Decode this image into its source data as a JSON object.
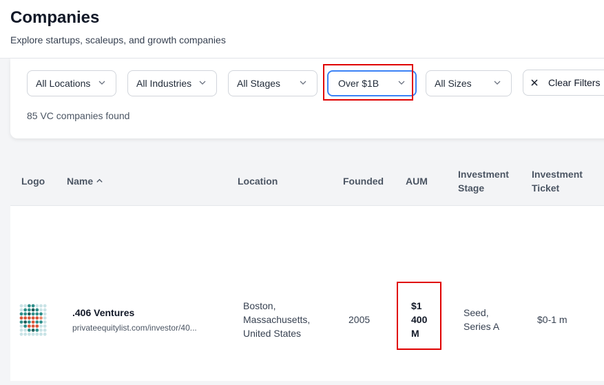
{
  "header": {
    "title": "Companies",
    "subtitle": "Explore startups, scaleups, and growth companies"
  },
  "filters": {
    "location": "All Locations",
    "industry": "All Industries",
    "stage": "All Stages",
    "aum": "Over $1B",
    "size": "All Sizes",
    "clear_label": "Clear Filters"
  },
  "results": {
    "count_text": "85 VC companies found"
  },
  "table": {
    "columns": {
      "logo": "Logo",
      "name": "Name",
      "location": "Location",
      "founded": "Founded",
      "aum": "AUM",
      "stage_line1": "Investment",
      "stage_line2": "Stage",
      "ticket_line1": "Investment",
      "ticket_line2": "Ticket"
    },
    "rows": [
      {
        "name": ".406 Ventures",
        "url": "privateequitylist.com/investor/40...",
        "location_line1": "Boston,",
        "location_line2": "Massachusetts,",
        "location_line3": "United States",
        "founded": "2005",
        "aum_line1": "$1",
        "aum_line2": "400",
        "aum_line3": "M",
        "stage_line1": "Seed,",
        "stage_line2": "Series A",
        "ticket": "$0-1 m"
      }
    ]
  },
  "colors": {
    "accent": "#3b82f6",
    "highlight": "#e00000"
  }
}
